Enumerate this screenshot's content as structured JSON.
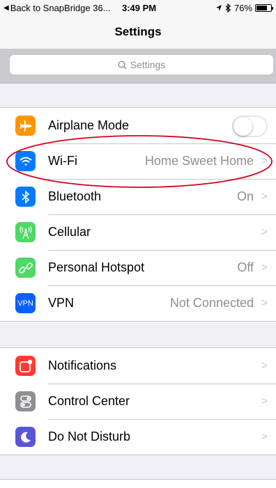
{
  "status_bar": {
    "back_label": "Back to SnapBridge 36...",
    "time": "3:49 PM",
    "battery_percent": "76%",
    "battery_level": 0.76
  },
  "nav": {
    "title": "Settings"
  },
  "search": {
    "placeholder": "Settings"
  },
  "groups": [
    {
      "rows": [
        {
          "label": "Airplane Mode",
          "icon": "airplane-icon",
          "color": "#ff9500",
          "value": "",
          "toggle": false
        },
        {
          "label": "Wi-Fi",
          "icon": "wifi-icon",
          "color": "#007aff",
          "value": "Home Sweet Home"
        },
        {
          "label": "Bluetooth",
          "icon": "bluetooth-icon",
          "color": "#007aff",
          "value": "On"
        },
        {
          "label": "Cellular",
          "icon": "cellular-icon",
          "color": "#4cd964",
          "value": ""
        },
        {
          "label": "Personal Hotspot",
          "icon": "hotspot-icon",
          "color": "#4cd964",
          "value": "Off"
        },
        {
          "label": "VPN",
          "icon": "vpn-icon",
          "icon_text": "VPN",
          "color": "#0a60ff",
          "value": "Not Connected"
        }
      ]
    },
    {
      "rows": [
        {
          "label": "Notifications",
          "icon": "notifications-icon",
          "color": "#ff3b30",
          "value": ""
        },
        {
          "label": "Control Center",
          "icon": "control-center-icon",
          "color": "#8e8e93",
          "value": ""
        },
        {
          "label": "Do Not Disturb",
          "icon": "moon-icon",
          "color": "#5856d6",
          "value": ""
        }
      ]
    }
  ],
  "annotation_color": "#d0021b"
}
